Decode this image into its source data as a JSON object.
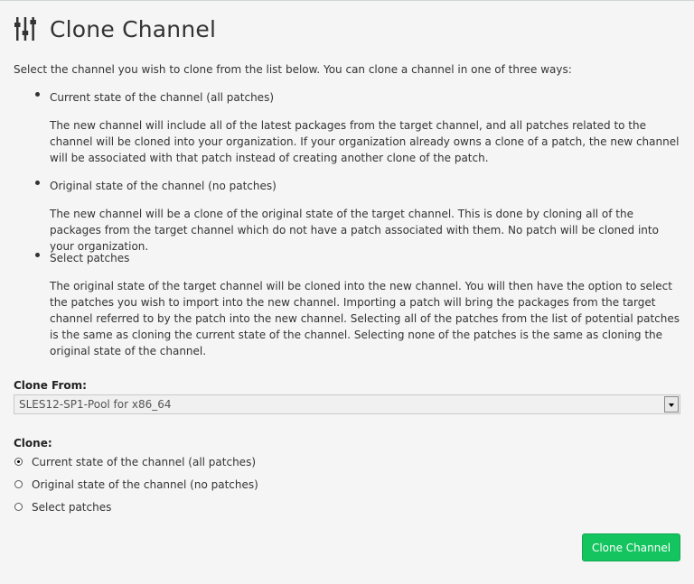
{
  "page": {
    "title": "Clone Channel",
    "header_icon": "mixer-sliders-icon",
    "intro": "Select the channel you wish to clone from the list below. You can clone a channel in one of three ways:"
  },
  "options": [
    {
      "title": "Current state of the channel (all patches)",
      "description": "The new channel will include all of the latest packages from the target channel, and all patches related to the channel will be cloned into your organization. If your organization already owns a clone of a patch, the new channel will be associated with that patch instead of creating another clone of the patch."
    },
    {
      "title": "Original state of the channel (no patches)",
      "description": "The new channel will be a clone of the original state of the target channel. This is done by cloning all of the packages from the target channel which do not have a patch associated with them. No patch will be cloned into your organization."
    },
    {
      "title": "Select patches",
      "description": "The original state of the target channel will be cloned into the new channel. You will then have the option to select the patches you wish to import into the new channel. Importing a patch will bring the packages from the target channel referred to by the patch into the new channel. Selecting all of the patches from the list of potential patches is the same as cloning the current state of the channel. Selecting none of the patches is the same as cloning the original state of the channel."
    }
  ],
  "form": {
    "clone_from_label": "Clone From:",
    "clone_from_value": "SLES12-SP1-Pool for x86_64",
    "clone_label": "Clone:",
    "radio_options": [
      {
        "label": "Current state of the channel (all patches)",
        "checked": true
      },
      {
        "label": "Original state of the channel (no patches)",
        "checked": false
      },
      {
        "label": "Select patches",
        "checked": false
      }
    ],
    "submit_label": "Clone Channel"
  },
  "colors": {
    "button": "#14c45f",
    "background": "#f5f5f5"
  }
}
